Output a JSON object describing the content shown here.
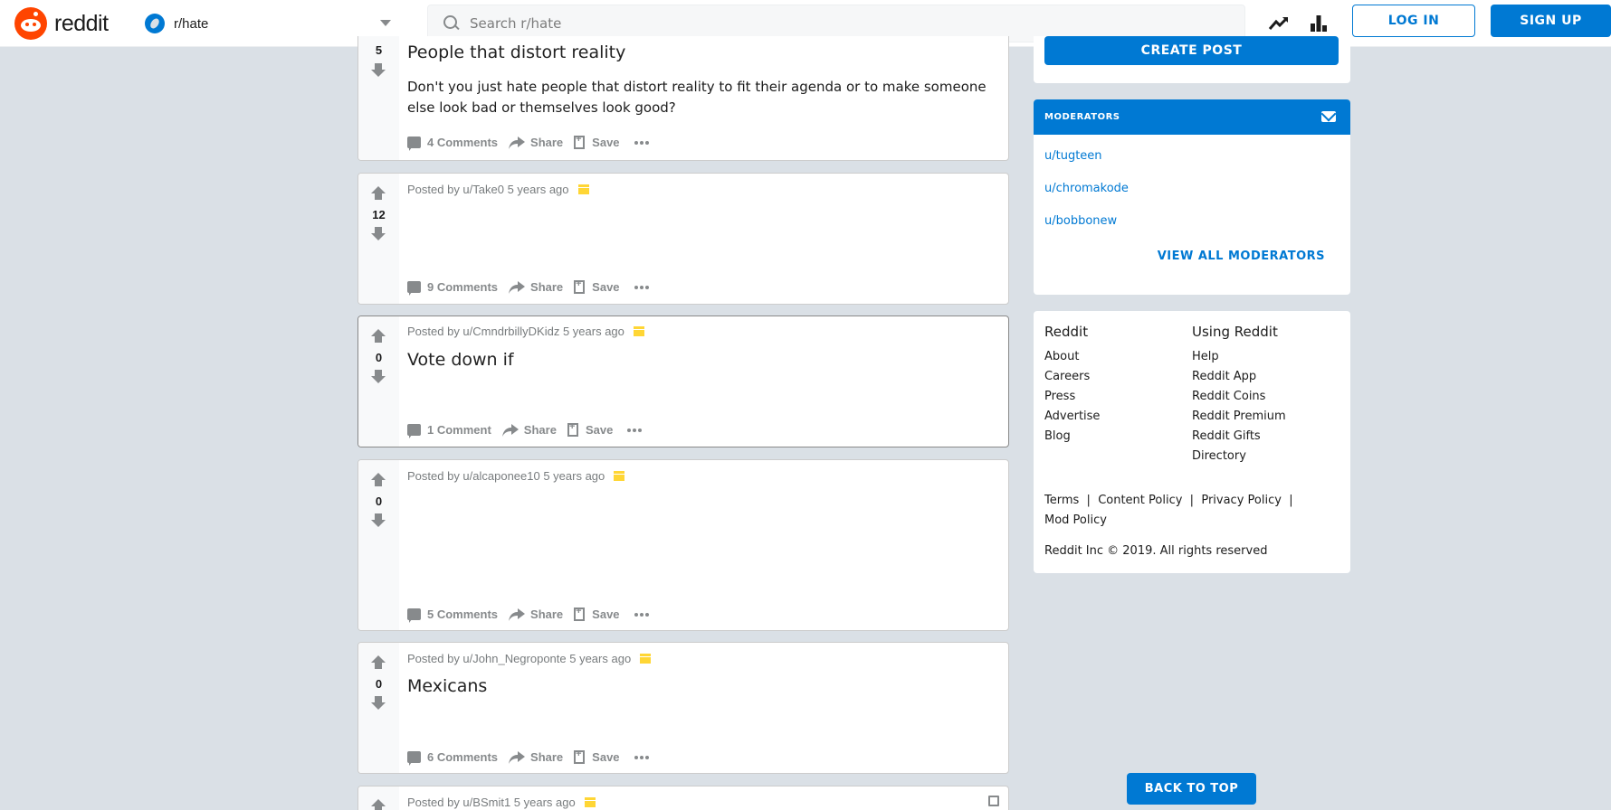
{
  "header": {
    "logo_text": "reddit",
    "subreddit": "r/hate",
    "search_placeholder": "Search r/hate",
    "login_label": "LOG IN",
    "signup_label": "SIGN UP"
  },
  "posts": [
    {
      "score": "5",
      "title": "People that distort reality",
      "body": "Don't you just hate people that distort reality to fit their agenda or to make someone else look bad or themselves look good?",
      "comments": "4 Comments",
      "share": "Share",
      "save": "Save"
    },
    {
      "score": "12",
      "meta": "Posted by u/Take0 5 years ago",
      "comments": "9 Comments",
      "share": "Share",
      "save": "Save"
    },
    {
      "score": "0",
      "meta": "Posted by u/CmndrbillyDKidz 5 years ago",
      "title": "Vote down if",
      "comments": "1 Comment",
      "share": "Share",
      "save": "Save"
    },
    {
      "score": "0",
      "meta": "Posted by u/alcaponee10 5 years ago",
      "comments": "5 Comments",
      "share": "Share",
      "save": "Save"
    },
    {
      "score": "0",
      "meta": "Posted by u/John_Negroponte 5 years ago",
      "title": "Mexicans",
      "comments": "6 Comments",
      "share": "Share",
      "save": "Save"
    },
    {
      "meta": "Posted by u/BSmit1 5 years ago"
    }
  ],
  "sidebar": {
    "create_post": "CREATE POST",
    "moderators_title": "MODERATORS",
    "moderators": [
      "u/tugteen",
      "u/chromakode",
      "u/bobbonew"
    ],
    "view_all": "VIEW ALL MODERATORS",
    "footer": {
      "col1_title": "Reddit",
      "col1_links": [
        "About",
        "Careers",
        "Press",
        "Advertise",
        "Blog"
      ],
      "col2_title": "Using Reddit",
      "col2_links": [
        "Help",
        "Reddit App",
        "Reddit Coins",
        "Reddit Premium",
        "Reddit Gifts",
        "Directory"
      ],
      "policy_line1": "Terms  |  Content Policy  |  Privacy Policy  |",
      "policy_line2": "Mod Policy",
      "copyright": "Reddit Inc © 2019. All rights reserved"
    },
    "back_to_top": "BACK TO TOP"
  },
  "colors": {
    "accent": "#0079d3",
    "brand": "#ff4500",
    "background": "#dae0e6",
    "archived": "#ffd635"
  }
}
